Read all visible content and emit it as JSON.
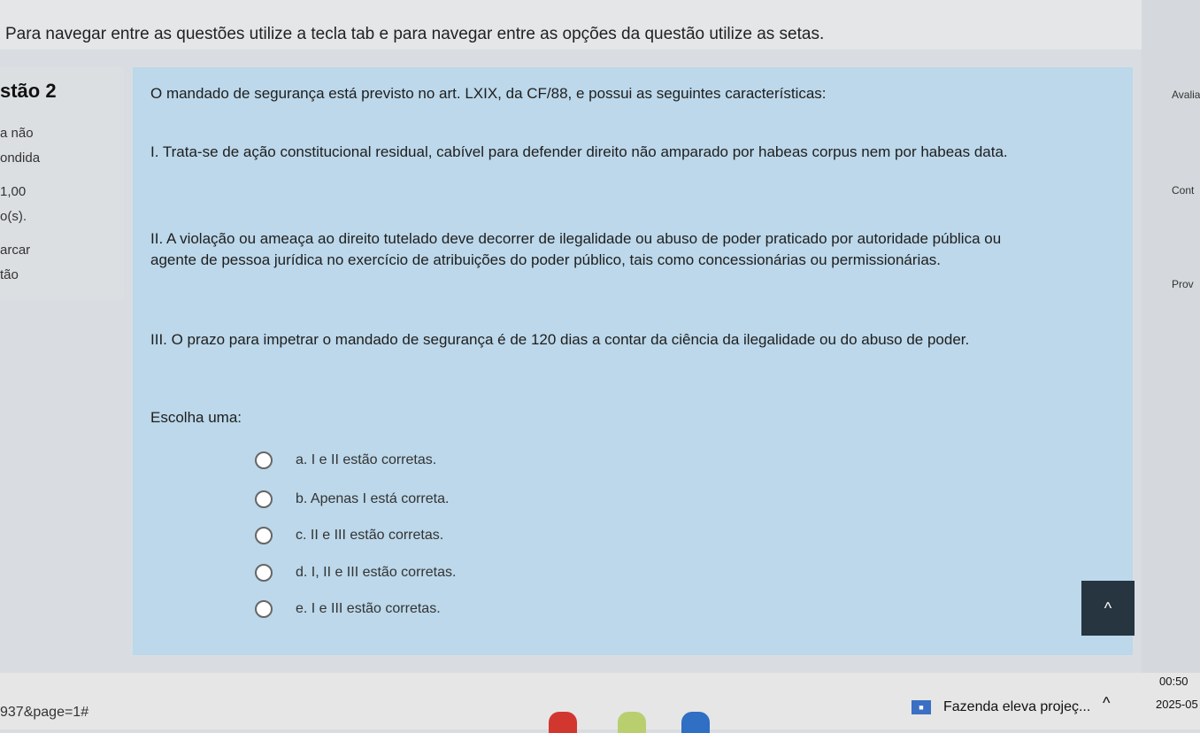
{
  "instruction": "Para navegar entre as questões utilize a tecla tab e para navegar entre as opções da questão utilize as setas.",
  "info": {
    "question_label": "stão 2",
    "status_line1": "a não",
    "status_line2": "ondida",
    "score": "1,00",
    "score_suffix": "o(s).",
    "flag_line1": "arcar",
    "flag_line2": "tão"
  },
  "question": {
    "stem": "O mandado de segurança está previsto no art. LXIX, da CF/88, e possui as seguintes características:",
    "item1": "I. Trata-se de ação constitucional residual, cabível para defender direito não amparado por habeas corpus nem por habeas data.",
    "item2": "II. A violação ou ameaça ao direito tutelado deve decorrer de ilegalidade ou abuso de poder praticado por autoridade pública ou agente de pessoa jurídica no exercício de atribuições do poder público, tais como concessionárias ou permissionárias.",
    "item3": "III. O prazo para impetrar o mandado de segurança é de 120 dias a contar da ciência da ilegalidade ou do abuso de poder.",
    "choose": "Escolha uma:",
    "options": [
      "a. I e II estão corretas.",
      "b. Apenas I está correta.",
      "c. II e III estão corretas.",
      "d. I, II e III estão corretas.",
      "e. I e III estão corretas."
    ]
  },
  "right_panel": {
    "t1": "Avalia",
    "t2": "Cont",
    "t3": "Prov"
  },
  "taskbar": {
    "url_fragment": "937&page=1#",
    "news": "Fazenda eleva projeç...",
    "time": "00:50",
    "date": "2025-05"
  }
}
